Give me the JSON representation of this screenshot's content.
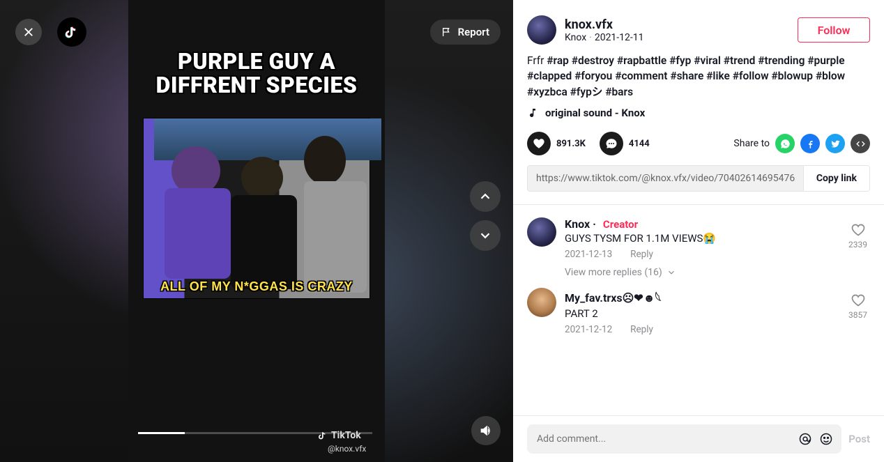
{
  "video": {
    "meme_title_l1": "PURPLE GUY A",
    "meme_title_l2": "DIFFRENT SPECIES",
    "meme_caption": "ALL OF MY N*GGAS IS CRAZY",
    "watermark": "TikTok",
    "watermark_handle": "@knox.vfx",
    "report_label": "Report"
  },
  "author": {
    "username": "knox.vfx",
    "display_name": "Knox",
    "date": "2021-12-11",
    "follow_label": "Follow"
  },
  "caption": {
    "lead": "Frfr ",
    "tags": [
      "#rap",
      "#destroy",
      "#rapbattle",
      "#fyp",
      "#viral",
      "#trend",
      "#trending",
      "#purple",
      "#clapped",
      "#foryou",
      "#comment",
      "#share",
      "#like",
      "#follow",
      "#blowup",
      "#blow",
      "#xyzbca",
      "#fypシ",
      "#bars"
    ]
  },
  "music": {
    "label": "original sound - Knox"
  },
  "stats": {
    "likes": "891.3K",
    "comments": "4144"
  },
  "share": {
    "label": "Share to",
    "link": "https://www.tiktok.com/@knox.vfx/video/70402614695476...",
    "copy_label": "Copy link"
  },
  "comments": [
    {
      "name": "Knox",
      "creator": true,
      "creator_label": "Creator",
      "text": "GUYS TYSM FOR 1.1M VIEWS😭",
      "date": "2021-12-13",
      "reply_label": "Reply",
      "likes": "2339",
      "replies_label": "View more replies (16)"
    },
    {
      "name": "My_fav.trxs☹︎❤︎☻𓆩",
      "creator": false,
      "text": "PART 2",
      "date": "2021-12-12",
      "reply_label": "Reply",
      "likes": "3857"
    }
  ],
  "composer": {
    "placeholder": "Add comment...",
    "post_label": "Post"
  }
}
